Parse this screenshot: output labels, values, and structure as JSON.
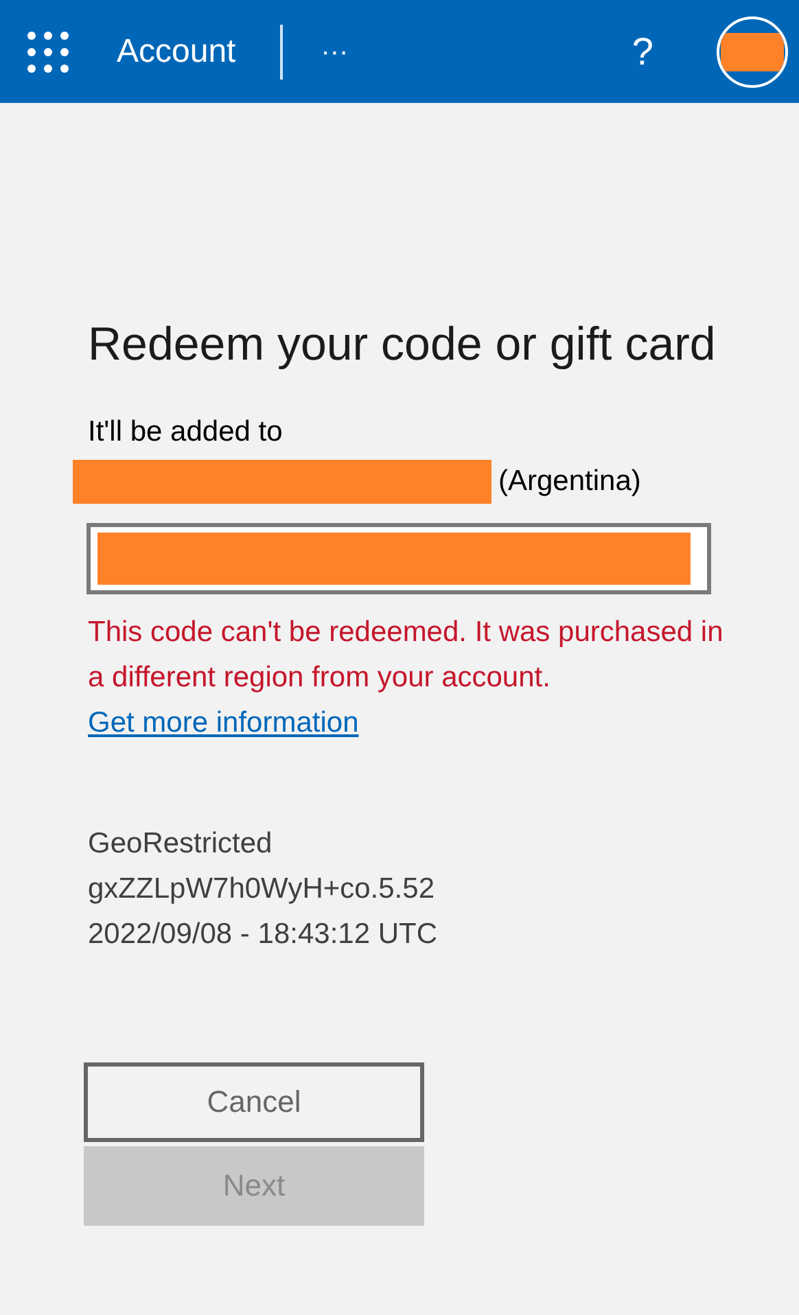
{
  "header": {
    "title": "Account",
    "more": "···",
    "help": "?"
  },
  "title": "Redeem your code or gift card",
  "added_to": {
    "label": "It'll be added to",
    "region": "(Argentina)"
  },
  "error": {
    "text": "This code can't be redeemed. It was purchased in a different region from your account.",
    "link": "Get more information"
  },
  "details": [
    "GeoRestricted",
    "gxZZLpW7h0WyH+co.5.52",
    "2022/09/08 - 18:43:12 UTC"
  ],
  "buttons": [
    {
      "label": "Cancel",
      "kind": "secondary",
      "disabled": false
    },
    {
      "label": "Next",
      "kind": "primary",
      "disabled": true
    }
  ]
}
